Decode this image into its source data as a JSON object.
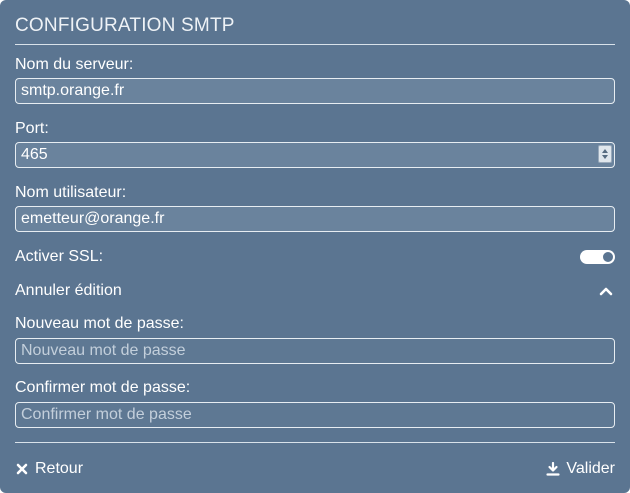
{
  "title": "CONFIGURATION SMTP",
  "server": {
    "label": "Nom du serveur:",
    "value": "smtp.orange.fr"
  },
  "port": {
    "label": "Port:",
    "value": "465"
  },
  "user": {
    "label": "Nom utilisateur:",
    "value": "emetteur@orange.fr"
  },
  "ssl": {
    "label": "Activer SSL:",
    "enabled": true
  },
  "cancel_edit": {
    "label": "Annuler édition",
    "icon": "chevron-up-icon"
  },
  "new_password": {
    "label": "Nouveau mot de passe:",
    "placeholder": "Nouveau mot de passe"
  },
  "confirm_password": {
    "label": "Confirmer mot de passe:",
    "placeholder": "Confirmer mot de passe"
  },
  "footer": {
    "back_label": "Retour",
    "back_icon": "close-icon",
    "validate_label": "Valider",
    "validate_icon": "download-icon"
  },
  "colors": {
    "panel_background": "#5b7591",
    "field_background": "#6a839d",
    "text": "#ffffff"
  }
}
